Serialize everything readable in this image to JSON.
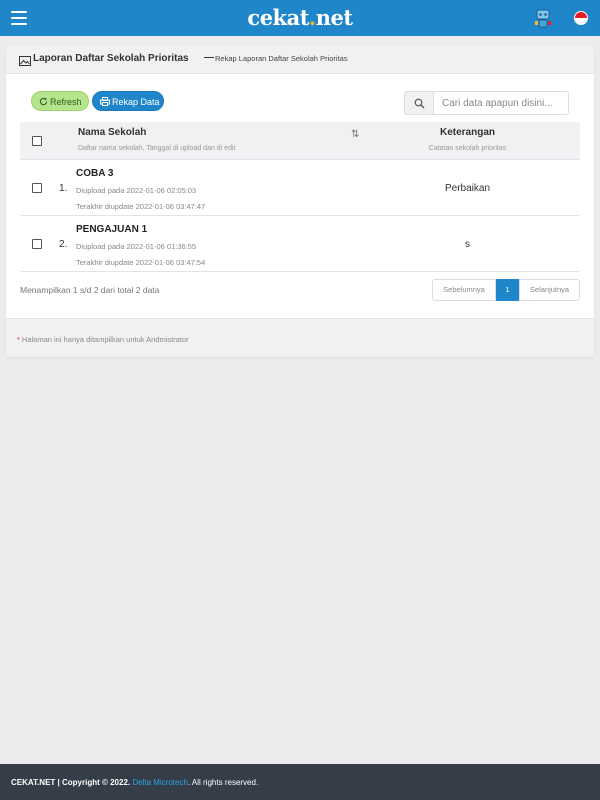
{
  "app": {
    "brand_name": "cekat",
    "brand_dot": ".",
    "brand_tld": "net",
    "menu_icon": "hamburger-icon",
    "assistant_icon": "robot-icon",
    "language_icon": "indonesia-flag-icon"
  },
  "page": {
    "title": "Laporan Daftar Sekolah Prioritas",
    "separator": "—",
    "subtitle": "Rekap Laporan Daftar Sekolah Prioritas",
    "title_icon": "image-icon"
  },
  "toolbar": {
    "refresh_label": "Refresh",
    "refresh_icon": "refresh-icon",
    "rekap_label": "Rekap Data",
    "rekap_icon": "printer-icon"
  },
  "search": {
    "placeholder": "Cari data apapun disini...",
    "value": "",
    "icon": "search-icon"
  },
  "table": {
    "columns": [
      {
        "label": "Nama Sekolah",
        "sub": "Daftar nama sekolah, Tanggal di upload dan di edit",
        "sort_icon": "⇅"
      },
      {
        "label": "Keterangan",
        "sub": "Catatan sekolah prioritas"
      }
    ],
    "rows": [
      {
        "number": "1.",
        "name": "COBA 3",
        "uploaded": "Diupload pada 2022-01-06 02:05:03",
        "updated": "Terakhir diupdate 2022-01-06 03:47:47",
        "keterangan": "Perbaikan"
      },
      {
        "number": "2.",
        "name": "PENGAJUAN 1",
        "uploaded": "Diupload pada 2022-01-06 01:36:55",
        "updated": "Terakhir diupdate 2022-01-06 03:47:54",
        "keterangan": "s"
      }
    ]
  },
  "pagination": {
    "info": "Menampilkan 1 s/d 2 dari total 2 data",
    "prev_label": "Sebelumnya",
    "current_page": "1",
    "next_label": "Selanjutnya"
  },
  "note": {
    "star": "*",
    "text": "Halaman ini hanya ditampilkan untuk Andmistrator"
  },
  "footer": {
    "brand": "CEKAT.NET",
    "copyright": " | Copyright © 2022. ",
    "company": "Delta Microtech",
    "rights": ". All rights reserved."
  },
  "colors": {
    "primary": "#1f86c9",
    "refresh_button": "#b5e48c",
    "footer_bg": "#353d48",
    "page_bg": "#ececee",
    "accent_link": "#2aa3e6"
  }
}
